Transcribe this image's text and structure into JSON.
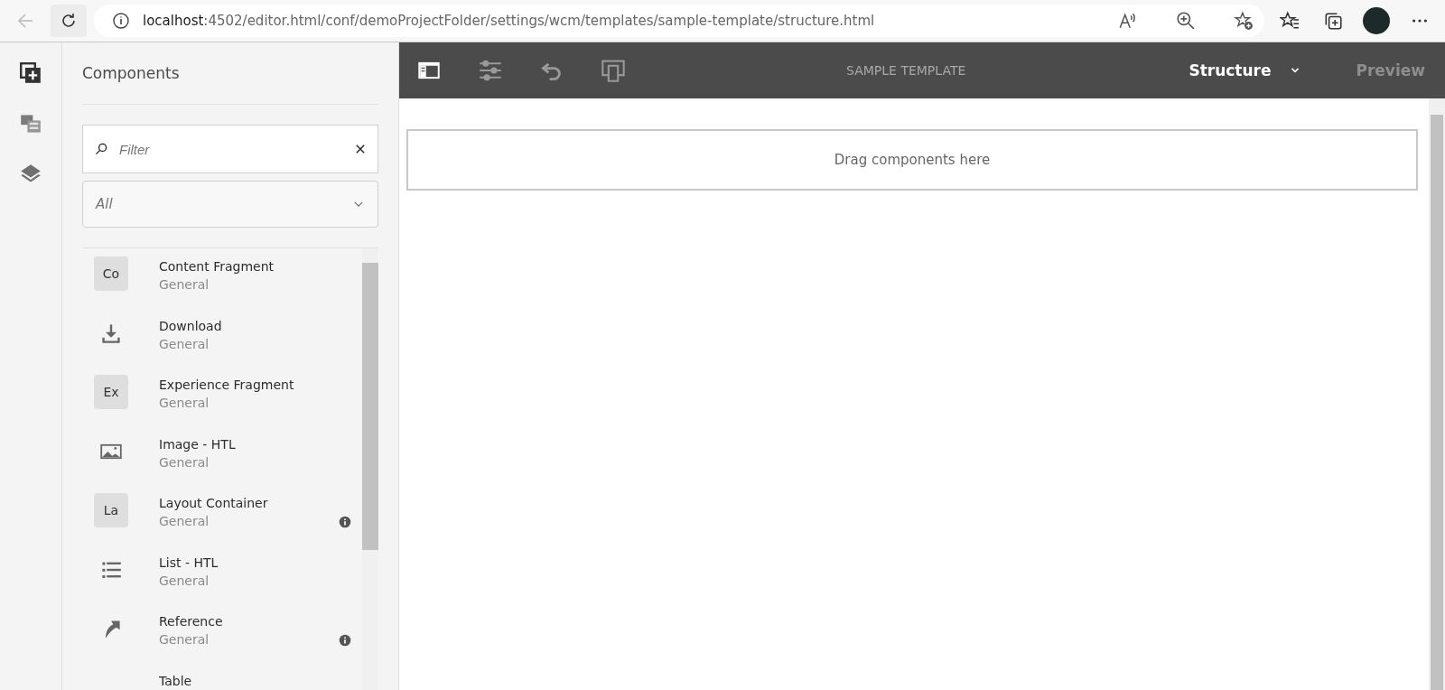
{
  "browser": {
    "url_host": "localhost",
    "url_path": ":4502/editor.html/conf/demoProjectFolder/settings/wcm/templates/sample-template/structure.html"
  },
  "side_rail": [
    {
      "kind": "components",
      "selected": true
    },
    {
      "kind": "assets",
      "selected": false
    },
    {
      "kind": "layers",
      "selected": false
    }
  ],
  "panel": {
    "title": "Components",
    "filter": {
      "placeholder": "Filter"
    },
    "group_select": {
      "value": "All"
    },
    "items": [
      {
        "kind": "abbr",
        "abbr": "Co",
        "name": "Content Fragment",
        "group": "General",
        "info": false
      },
      {
        "kind": "download",
        "name": "Download",
        "group": "General",
        "info": false
      },
      {
        "kind": "abbr",
        "abbr": "Ex",
        "name": "Experience Fragment",
        "group": "General",
        "info": false
      },
      {
        "kind": "image",
        "name": "Image - HTL",
        "group": "General",
        "info": false
      },
      {
        "kind": "abbr",
        "abbr": "La",
        "name": "Layout Container",
        "group": "General",
        "info": true
      },
      {
        "kind": "list",
        "name": "List - HTL",
        "group": "General",
        "info": false
      },
      {
        "kind": "reference",
        "name": "Reference",
        "group": "General",
        "info": true
      },
      {
        "kind": "none",
        "name": "Table"
      }
    ]
  },
  "toolbar": {
    "title": "SAMPLE TEMPLATE",
    "mode": "Structure",
    "preview": "Preview"
  },
  "canvas": {
    "drop_zone": "Drag components here"
  }
}
